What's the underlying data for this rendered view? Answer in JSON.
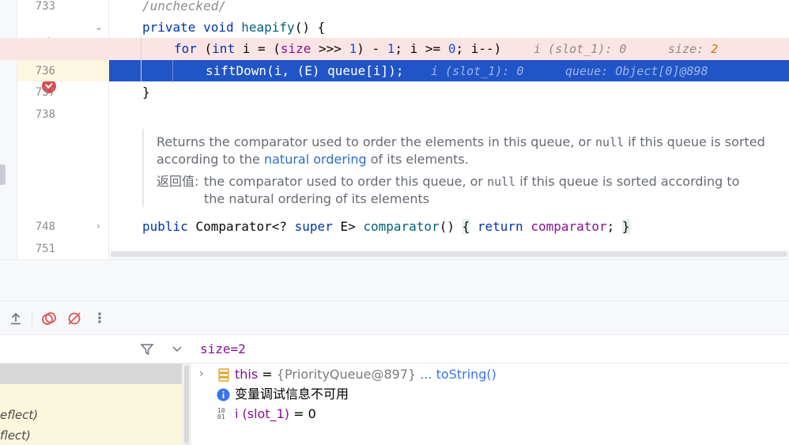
{
  "editor": {
    "lines": [
      {
        "num": "733",
        "text": "/unchecked/"
      },
      {
        "num": "",
        "kw1": "private",
        "kw2": "void",
        "fn": "heapify",
        "rest": "() {"
      },
      {
        "num": "",
        "kw": "for",
        "p1": " (",
        "kw_int": "int",
        "p2": " i = (",
        "field": "size",
        "p3": " >>> ",
        "n1": "1",
        "p4": ") - ",
        "n2": "1",
        "p5": "; i >= ",
        "n3": "0",
        "p6": "; i--)",
        "hint1": "i (slot_1): 0",
        "hint2_label": "size: ",
        "hint2_value": "2"
      },
      {
        "num": "736",
        "code": "siftDown(i, (E) queue[i]);",
        "hint1": "i (slot_1): 0",
        "hint2": "queue: Object[0]@898"
      },
      {
        "num": "737",
        "code": "}"
      },
      {
        "num": "738",
        "code": ""
      },
      {
        "num": "748",
        "kw1": "public",
        "p1": " Comparator<? ",
        "kw2": "super",
        "p2": " E> ",
        "fn": "comparator",
        "p3": "() ",
        "brace_open": "{",
        "kw3": "return",
        "field": "comparator",
        "semi": ";",
        "brace_close": "}"
      },
      {
        "num": "751",
        "code": ""
      }
    ],
    "doc": {
      "p1_a": "Returns the comparator used to order the elements in this queue, or ",
      "p1_null": "null",
      "p1_b": " if this queue is sorted according to the ",
      "p1_link": "natural ordering",
      "p1_c": " of its elements.",
      "ret_label": "返回值:",
      "ret_a": "the comparator used to order this queue, or ",
      "ret_null": "null",
      "ret_b": " if this queue is sorted according to the natural ordering of its elements"
    }
  },
  "frames": {
    "items": [
      "eflect)",
      "flect)"
    ]
  },
  "variables": {
    "eval_text": "size=2",
    "rows": [
      {
        "name": "this",
        "eq": " = ",
        "value": "{PriorityQueue@897}",
        "link": " ... toString()"
      },
      {
        "info": "变量调试信息不可用"
      },
      {
        "name": "i (slot_1)",
        "eq": " = ",
        "value": "0"
      }
    ]
  },
  "colors": {
    "current_line": "#2154c6",
    "breakpoint_line": "#fbe4e4",
    "keyword": "#0033b3",
    "field": "#871094"
  }
}
